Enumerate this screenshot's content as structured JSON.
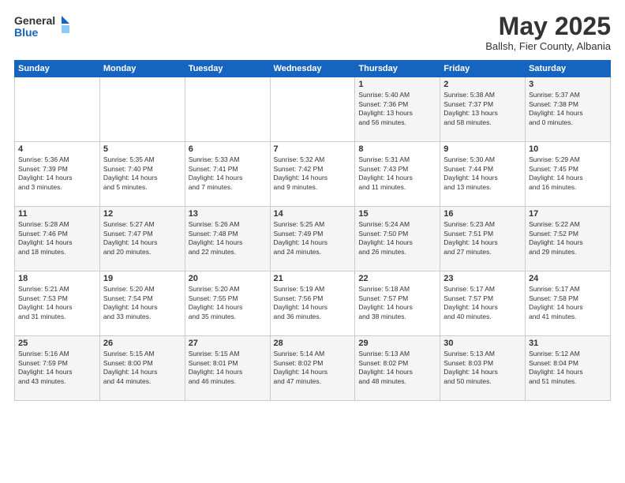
{
  "header": {
    "logo_general": "General",
    "logo_blue": "Blue",
    "month_title": "May 2025",
    "subtitle": "Ballsh, Fier County, Albania"
  },
  "weekdays": [
    "Sunday",
    "Monday",
    "Tuesday",
    "Wednesday",
    "Thursday",
    "Friday",
    "Saturday"
  ],
  "weeks": [
    [
      {
        "day": "",
        "info": ""
      },
      {
        "day": "",
        "info": ""
      },
      {
        "day": "",
        "info": ""
      },
      {
        "day": "",
        "info": ""
      },
      {
        "day": "1",
        "info": "Sunrise: 5:40 AM\nSunset: 7:36 PM\nDaylight: 13 hours\nand 56 minutes."
      },
      {
        "day": "2",
        "info": "Sunrise: 5:38 AM\nSunset: 7:37 PM\nDaylight: 13 hours\nand 58 minutes."
      },
      {
        "day": "3",
        "info": "Sunrise: 5:37 AM\nSunset: 7:38 PM\nDaylight: 14 hours\nand 0 minutes."
      }
    ],
    [
      {
        "day": "4",
        "info": "Sunrise: 5:36 AM\nSunset: 7:39 PM\nDaylight: 14 hours\nand 3 minutes."
      },
      {
        "day": "5",
        "info": "Sunrise: 5:35 AM\nSunset: 7:40 PM\nDaylight: 14 hours\nand 5 minutes."
      },
      {
        "day": "6",
        "info": "Sunrise: 5:33 AM\nSunset: 7:41 PM\nDaylight: 14 hours\nand 7 minutes."
      },
      {
        "day": "7",
        "info": "Sunrise: 5:32 AM\nSunset: 7:42 PM\nDaylight: 14 hours\nand 9 minutes."
      },
      {
        "day": "8",
        "info": "Sunrise: 5:31 AM\nSunset: 7:43 PM\nDaylight: 14 hours\nand 11 minutes."
      },
      {
        "day": "9",
        "info": "Sunrise: 5:30 AM\nSunset: 7:44 PM\nDaylight: 14 hours\nand 13 minutes."
      },
      {
        "day": "10",
        "info": "Sunrise: 5:29 AM\nSunset: 7:45 PM\nDaylight: 14 hours\nand 16 minutes."
      }
    ],
    [
      {
        "day": "11",
        "info": "Sunrise: 5:28 AM\nSunset: 7:46 PM\nDaylight: 14 hours\nand 18 minutes."
      },
      {
        "day": "12",
        "info": "Sunrise: 5:27 AM\nSunset: 7:47 PM\nDaylight: 14 hours\nand 20 minutes."
      },
      {
        "day": "13",
        "info": "Sunrise: 5:26 AM\nSunset: 7:48 PM\nDaylight: 14 hours\nand 22 minutes."
      },
      {
        "day": "14",
        "info": "Sunrise: 5:25 AM\nSunset: 7:49 PM\nDaylight: 14 hours\nand 24 minutes."
      },
      {
        "day": "15",
        "info": "Sunrise: 5:24 AM\nSunset: 7:50 PM\nDaylight: 14 hours\nand 26 minutes."
      },
      {
        "day": "16",
        "info": "Sunrise: 5:23 AM\nSunset: 7:51 PM\nDaylight: 14 hours\nand 27 minutes."
      },
      {
        "day": "17",
        "info": "Sunrise: 5:22 AM\nSunset: 7:52 PM\nDaylight: 14 hours\nand 29 minutes."
      }
    ],
    [
      {
        "day": "18",
        "info": "Sunrise: 5:21 AM\nSunset: 7:53 PM\nDaylight: 14 hours\nand 31 minutes."
      },
      {
        "day": "19",
        "info": "Sunrise: 5:20 AM\nSunset: 7:54 PM\nDaylight: 14 hours\nand 33 minutes."
      },
      {
        "day": "20",
        "info": "Sunrise: 5:20 AM\nSunset: 7:55 PM\nDaylight: 14 hours\nand 35 minutes."
      },
      {
        "day": "21",
        "info": "Sunrise: 5:19 AM\nSunset: 7:56 PM\nDaylight: 14 hours\nand 36 minutes."
      },
      {
        "day": "22",
        "info": "Sunrise: 5:18 AM\nSunset: 7:57 PM\nDaylight: 14 hours\nand 38 minutes."
      },
      {
        "day": "23",
        "info": "Sunrise: 5:17 AM\nSunset: 7:57 PM\nDaylight: 14 hours\nand 40 minutes."
      },
      {
        "day": "24",
        "info": "Sunrise: 5:17 AM\nSunset: 7:58 PM\nDaylight: 14 hours\nand 41 minutes."
      }
    ],
    [
      {
        "day": "25",
        "info": "Sunrise: 5:16 AM\nSunset: 7:59 PM\nDaylight: 14 hours\nand 43 minutes."
      },
      {
        "day": "26",
        "info": "Sunrise: 5:15 AM\nSunset: 8:00 PM\nDaylight: 14 hours\nand 44 minutes."
      },
      {
        "day": "27",
        "info": "Sunrise: 5:15 AM\nSunset: 8:01 PM\nDaylight: 14 hours\nand 46 minutes."
      },
      {
        "day": "28",
        "info": "Sunrise: 5:14 AM\nSunset: 8:02 PM\nDaylight: 14 hours\nand 47 minutes."
      },
      {
        "day": "29",
        "info": "Sunrise: 5:13 AM\nSunset: 8:02 PM\nDaylight: 14 hours\nand 48 minutes."
      },
      {
        "day": "30",
        "info": "Sunrise: 5:13 AM\nSunset: 8:03 PM\nDaylight: 14 hours\nand 50 minutes."
      },
      {
        "day": "31",
        "info": "Sunrise: 5:12 AM\nSunset: 8:04 PM\nDaylight: 14 hours\nand 51 minutes."
      }
    ]
  ]
}
